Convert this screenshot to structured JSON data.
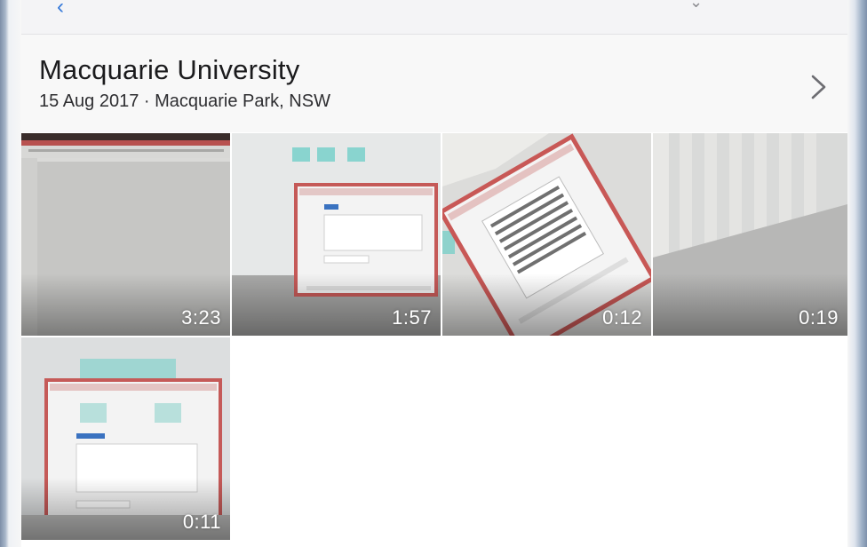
{
  "album": {
    "title": "Macquarie University",
    "subtitle": "15 Aug 2017 · Macquarie Park, NSW"
  },
  "videos": [
    {
      "duration": "3:23"
    },
    {
      "duration": "1:57"
    },
    {
      "duration": "0:12"
    },
    {
      "duration": "0:19"
    },
    {
      "duration": "0:11"
    }
  ],
  "icons": {
    "back": "back-chevron-icon",
    "detail": "chevron-right-icon"
  },
  "colors": {
    "accent": "#3478d9",
    "header_bg": "#f8f8f8",
    "text_primary": "#1b1b1d",
    "duration_text": "#ffffff"
  }
}
